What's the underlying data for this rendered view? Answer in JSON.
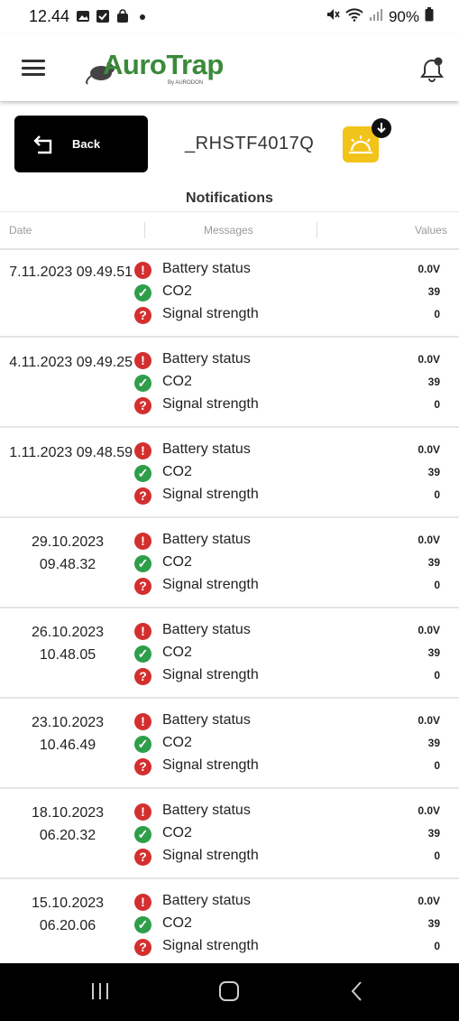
{
  "status_bar": {
    "time": "12.44",
    "battery": "90%"
  },
  "app": {
    "logo_text": "AuroTrap",
    "logo_sub": "By AURODON"
  },
  "header": {
    "back_label": "Back",
    "device_id": "_RHSTF4017Q"
  },
  "section_title": "Notifications",
  "columns": {
    "date": "Date",
    "messages": "Messages",
    "values": "Values"
  },
  "colors": {
    "error": "#d32f2f",
    "ok": "#2e9e4a",
    "accent": "#f2c318",
    "brand": "#3a8a3a"
  },
  "notifications": [
    {
      "date": "7.11.2023 09.49.51",
      "items": [
        {
          "status": "error",
          "icon": "exclamation-icon",
          "message": "Battery status",
          "value": "0.0V"
        },
        {
          "status": "ok",
          "icon": "check-icon",
          "message": "CO2",
          "value": "39"
        },
        {
          "status": "unknown",
          "icon": "question-icon",
          "message": "Signal strength",
          "value": "0"
        }
      ]
    },
    {
      "date": "4.11.2023 09.49.25",
      "items": [
        {
          "status": "error",
          "icon": "exclamation-icon",
          "message": "Battery status",
          "value": "0.0V"
        },
        {
          "status": "ok",
          "icon": "check-icon",
          "message": "CO2",
          "value": "39"
        },
        {
          "status": "unknown",
          "icon": "question-icon",
          "message": "Signal strength",
          "value": "0"
        }
      ]
    },
    {
      "date": "1.11.2023 09.48.59",
      "items": [
        {
          "status": "error",
          "icon": "exclamation-icon",
          "message": "Battery status",
          "value": "0.0V"
        },
        {
          "status": "ok",
          "icon": "check-icon",
          "message": "CO2",
          "value": "39"
        },
        {
          "status": "unknown",
          "icon": "question-icon",
          "message": "Signal strength",
          "value": "0"
        }
      ]
    },
    {
      "date_line1": "29.10.2023",
      "date_line2": "09.48.32",
      "items": [
        {
          "status": "error",
          "icon": "exclamation-icon",
          "message": "Battery status",
          "value": "0.0V"
        },
        {
          "status": "ok",
          "icon": "check-icon",
          "message": "CO2",
          "value": "39"
        },
        {
          "status": "unknown",
          "icon": "question-icon",
          "message": "Signal strength",
          "value": "0"
        }
      ]
    },
    {
      "date_line1": "26.10.2023",
      "date_line2": "10.48.05",
      "items": [
        {
          "status": "error",
          "icon": "exclamation-icon",
          "message": "Battery status",
          "value": "0.0V"
        },
        {
          "status": "ok",
          "icon": "check-icon",
          "message": "CO2",
          "value": "39"
        },
        {
          "status": "unknown",
          "icon": "question-icon",
          "message": "Signal strength",
          "value": "0"
        }
      ]
    },
    {
      "date_line1": "23.10.2023",
      "date_line2": "10.46.49",
      "items": [
        {
          "status": "error",
          "icon": "exclamation-icon",
          "message": "Battery status",
          "value": "0.0V"
        },
        {
          "status": "ok",
          "icon": "check-icon",
          "message": "CO2",
          "value": "39"
        },
        {
          "status": "unknown",
          "icon": "question-icon",
          "message": "Signal strength",
          "value": "0"
        }
      ]
    },
    {
      "date_line1": "18.10.2023",
      "date_line2": "06.20.32",
      "items": [
        {
          "status": "error",
          "icon": "exclamation-icon",
          "message": "Battery status",
          "value": "0.0V"
        },
        {
          "status": "ok",
          "icon": "check-icon",
          "message": "CO2",
          "value": "39"
        },
        {
          "status": "unknown",
          "icon": "question-icon",
          "message": "Signal strength",
          "value": "0"
        }
      ]
    },
    {
      "date_line1": "15.10.2023",
      "date_line2": "06.20.06",
      "items": [
        {
          "status": "error",
          "icon": "exclamation-icon",
          "message": "Battery status",
          "value": "0.0V"
        },
        {
          "status": "ok",
          "icon": "check-icon",
          "message": "CO2",
          "value": "39"
        },
        {
          "status": "unknown",
          "icon": "question-icon",
          "message": "Signal strength",
          "value": "0"
        }
      ]
    }
  ]
}
